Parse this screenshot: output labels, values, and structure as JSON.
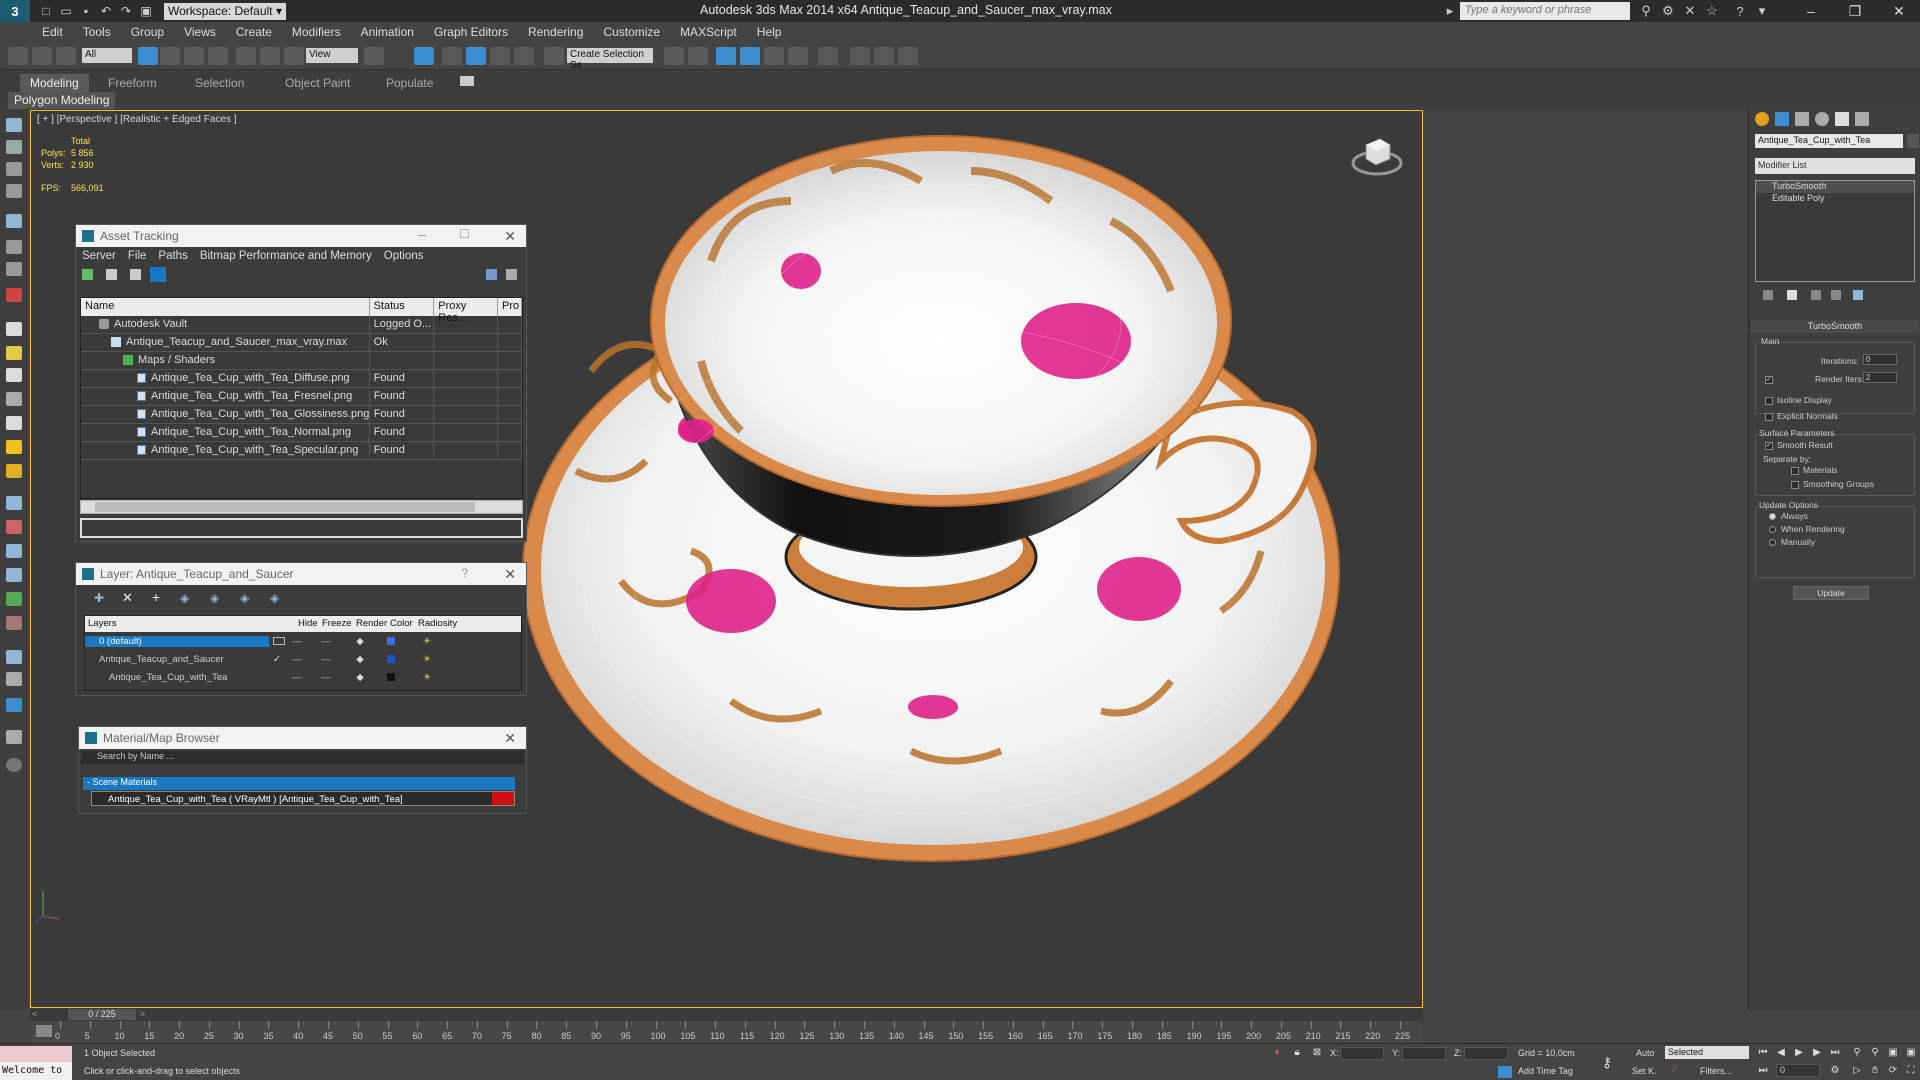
{
  "titlebar": {
    "workspace_label": "Workspace: Default",
    "window_title": "Autodesk 3ds Max  2014 x64     Antique_Teacup_and_Saucer_max_vray.max",
    "search_placeholder": "Type a keyword or phrase"
  },
  "menu": [
    "Edit",
    "Tools",
    "Group",
    "Views",
    "Create",
    "Modifiers",
    "Animation",
    "Graph Editors",
    "Rendering",
    "Customize",
    "MAXScript",
    "Help"
  ],
  "toolbar": {
    "selection_filter": "All",
    "ref_coord": "View",
    "named_selection": "Create Selection Se"
  },
  "ribbon": {
    "tabs": [
      "Modeling",
      "Freeform",
      "Selection",
      "Object Paint",
      "Populate"
    ],
    "active_tab": "Modeling",
    "panel_label": "Polygon Modeling"
  },
  "viewport": {
    "label": "[ + ] [Perspective ] [Realistic + Edged Faces ]",
    "stats": {
      "total_label": "Total",
      "polys_label": "Polys:",
      "polys_value": "5 856",
      "verts_label": "Verts:",
      "verts_value": "2 930",
      "fps_label": "FPS:",
      "fps_value": "566,091"
    }
  },
  "asset_tracking": {
    "title": "Asset Tracking",
    "menu": [
      "Server",
      "File",
      "Paths",
      "Bitmap Performance and Memory",
      "Options"
    ],
    "columns": [
      "Name",
      "Status",
      "Proxy Res...",
      "Pro"
    ],
    "rows": [
      {
        "name": "Autodesk Vault",
        "status": "Logged O...",
        "icon": "vault"
      },
      {
        "name": "Antique_Teacup_and_Saucer_max_vray.max",
        "status": "Ok",
        "icon": "max"
      },
      {
        "name": "Maps / Shaders",
        "status": "",
        "icon": "maps"
      },
      {
        "name": "Antique_Tea_Cup_with_Tea_Diffuse.png",
        "status": "Found",
        "icon": "file"
      },
      {
        "name": "Antique_Tea_Cup_with_Tea_Fresnel.png",
        "status": "Found",
        "icon": "file"
      },
      {
        "name": "Antique_Tea_Cup_with_Tea_Glossiness.png",
        "status": "Found",
        "icon": "file"
      },
      {
        "name": "Antique_Tea_Cup_with_Tea_Normal.png",
        "status": "Found",
        "icon": "file"
      },
      {
        "name": "Antique_Tea_Cup_with_Tea_Specular.png",
        "status": "Found",
        "icon": "file"
      }
    ]
  },
  "layer_panel": {
    "title": "Layer: Antique_Teacup_and_Saucer",
    "help": "?",
    "columns": [
      "Layers",
      "Hide",
      "Freeze",
      "Render",
      "Color",
      "Radiosity"
    ],
    "rows": [
      {
        "name": "0 (default)",
        "color": "#3a6fd8"
      },
      {
        "name": "Antique_Teacup_and_Saucer",
        "color": "#2255cc"
      },
      {
        "name": "Antique_Tea_Cup_with_Tea",
        "color": "#111111"
      }
    ]
  },
  "material_browser": {
    "title": "Material/Map Browser",
    "search_placeholder": "Search by Name ...",
    "section": "- Scene Materials",
    "item": "Antique_Tea_Cup_with_Tea  ( VRayMtl ) [Antique_Tea_Cup_with_Tea]"
  },
  "command_panel": {
    "object_name": "Antique_Tea_Cup_with_Tea",
    "modifier_list": "Modifier List",
    "stack": [
      "TurboSmooth",
      "Editable Poly"
    ],
    "turbosmooth": {
      "title": "TurboSmooth",
      "main": "Main",
      "iterations_label": "Iterations:",
      "iterations_value": "0",
      "render_iters_label": "Render Iters:",
      "render_iters_value": "2",
      "isoline": "Isoline Display",
      "explicit": "Explicit Normals",
      "surface_params": "Surface Parameters",
      "smooth_result": "Smooth Result",
      "separate_by": "Separate by:",
      "materials": "Materials",
      "smoothing_groups": "Smoothing Groups",
      "update_options": "Update Options",
      "always": "Always",
      "when_rendering": "When Rendering",
      "manually": "Manually",
      "update_btn": "Update"
    }
  },
  "timeline": {
    "slider": "0 / 225",
    "ticks": [
      "0",
      "5",
      "10",
      "15",
      "20",
      "25",
      "30",
      "35",
      "40",
      "45",
      "50",
      "55",
      "60",
      "65",
      "70",
      "75",
      "80",
      "85",
      "90",
      "95",
      "100",
      "105",
      "110",
      "115",
      "120",
      "125",
      "130",
      "135",
      "140",
      "145",
      "150",
      "155",
      "160",
      "165",
      "170",
      "175",
      "180",
      "185",
      "190",
      "195",
      "200",
      "205",
      "210",
      "215",
      "220",
      "225"
    ]
  },
  "statusbar": {
    "welcome": "Welcome to",
    "selection": "1 Object Selected",
    "prompt": "Click or click-and-drag to select objects",
    "x_label": "X:",
    "y_label": "Y:",
    "z_label": "Z:",
    "grid": "Grid = 10,0cm",
    "add_time_tag": "Add Time Tag",
    "auto": "Auto",
    "set_k": "Set K.",
    "key_mode": "Selected",
    "filters": "Filters...",
    "frame": "0"
  },
  "colors": {
    "accent": "#1a78c2",
    "viewport_border": "#ffbd3c",
    "stats_text": "#ffe34d",
    "saucer_rim": "#d98a4a",
    "rose": "#e0218a"
  }
}
